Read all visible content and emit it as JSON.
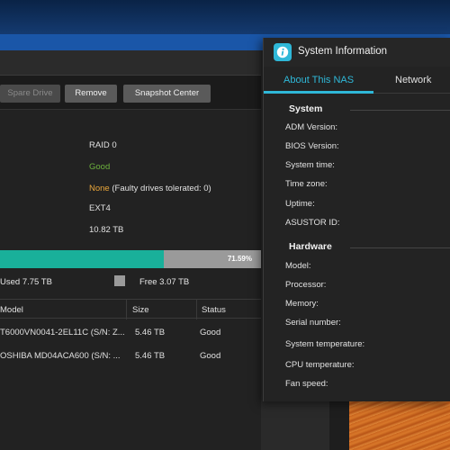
{
  "toolbar": {
    "spare_drive": "Spare Drive",
    "remove": "Remove",
    "snapshot_center": "Snapshot Center"
  },
  "volume": {
    "raid": "RAID 0",
    "status": "Good",
    "fault_tolerance_value": "None",
    "fault_tolerance_note": "(Faulty drives tolerated: 0)",
    "filesystem": "EXT4",
    "capacity": "10.82 TB",
    "usage_percent_label": "71.59%",
    "usage_fraction": 0.7159,
    "used_label": "Used 7.75 TB",
    "free_label": "Free 3.07 TB"
  },
  "drives_table": {
    "headers": [
      "Model",
      "Size",
      "Status"
    ],
    "rows": [
      {
        "model": "T6000VN0041-2EL11C (S/N: Z...",
        "size": "5.46 TB",
        "status": "Good"
      },
      {
        "model": "OSHIBA MD04ACA600 (S/N: ...",
        "size": "5.46 TB",
        "status": "Good"
      }
    ]
  },
  "sysinfo": {
    "title": "System Information",
    "tabs": [
      "About This NAS",
      "Network"
    ],
    "system_heading": "System",
    "system_labels": [
      "ADM Version:",
      "BIOS Version:",
      "System time:",
      "Time zone:",
      "Uptime:",
      "ASUSTOR ID:"
    ],
    "hardware_heading": "Hardware",
    "hardware_labels": [
      "Model:",
      "Processor:",
      "Memory:",
      "Serial number:",
      "System temperature:",
      "CPU temperature:",
      "Fan speed:"
    ]
  },
  "colors": {
    "accent": "#2fb8d8",
    "used": "#19b09a",
    "good": "#6cb13d",
    "warning": "#e8a53a"
  },
  "icons": [
    "info-icon"
  ]
}
